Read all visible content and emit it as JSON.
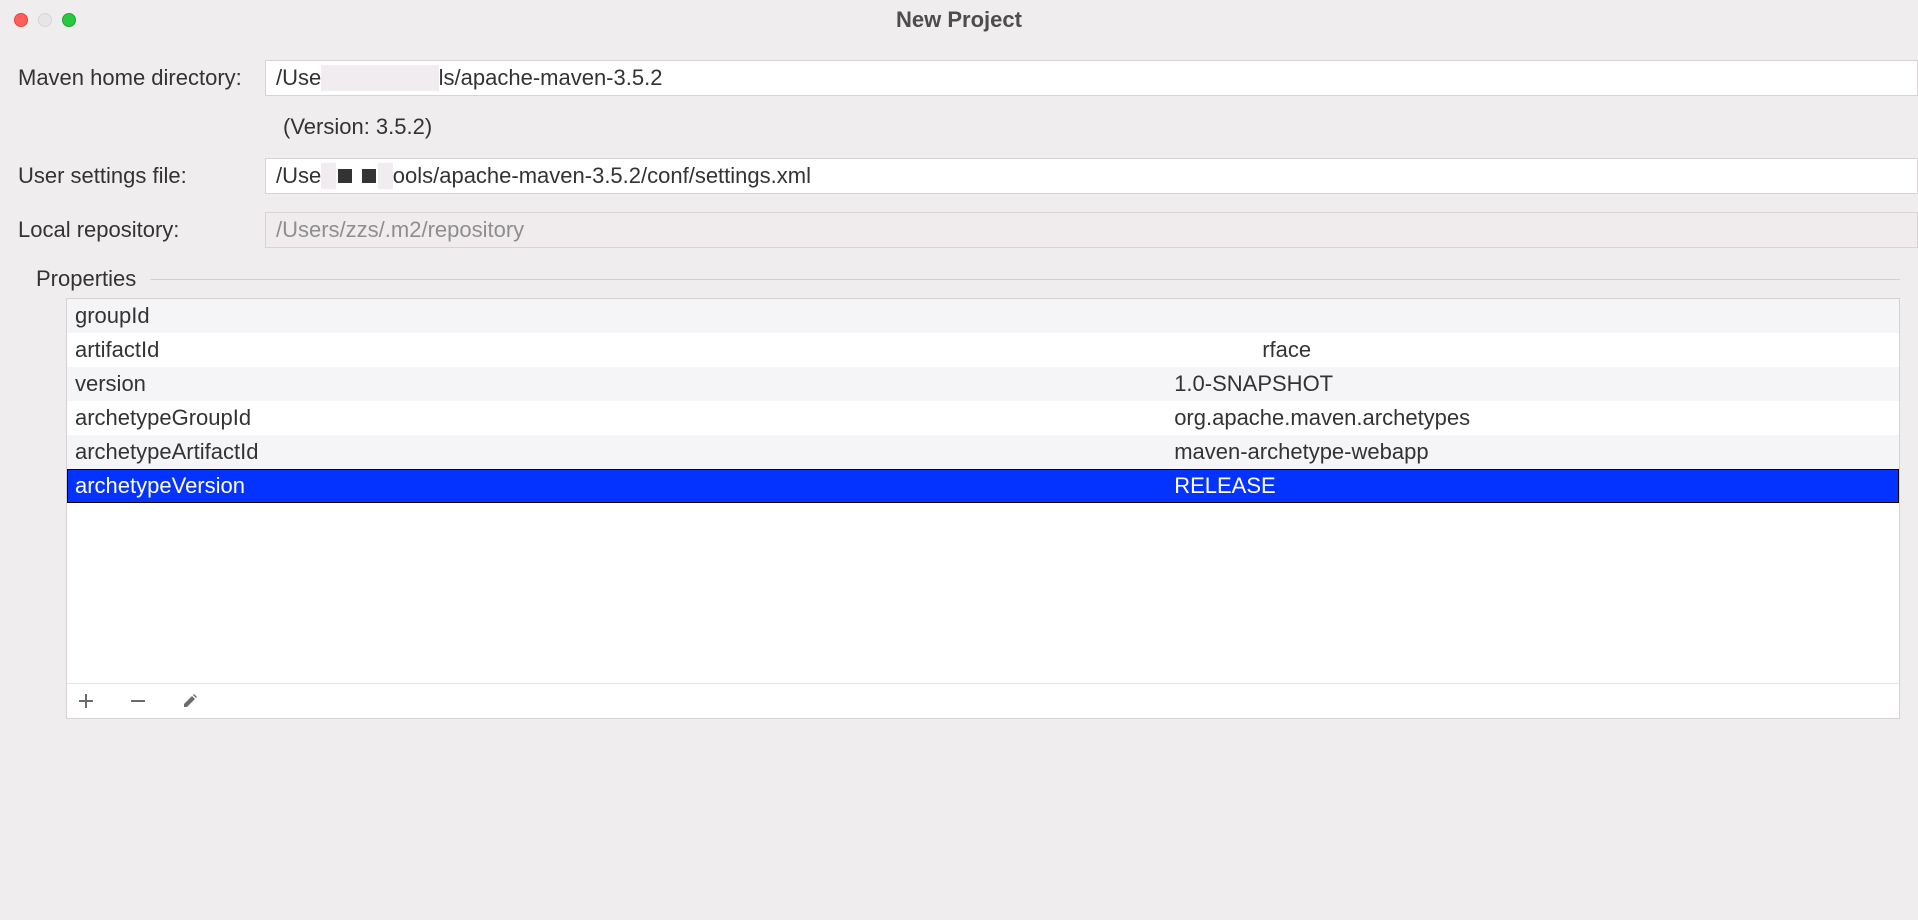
{
  "title": "New Project",
  "rows": {
    "mavenHome": {
      "label": "Maven home directory:",
      "prefix": "/Use",
      "suffix": "ls/apache-maven-3.5.2"
    },
    "versionNote": "(Version: 3.5.2)",
    "userSettings": {
      "label": "User settings file:",
      "prefix": "/Use",
      "suffix": "ools/apache-maven-3.5.2/conf/settings.xml"
    },
    "localRepo": {
      "label": "Local repository:",
      "value": "/Users/zzs/.m2/repository"
    }
  },
  "propertiesLabel": "Properties",
  "properties": [
    {
      "key": "groupId",
      "val": ""
    },
    {
      "key": "artifactId",
      "valSuffix": "rface"
    },
    {
      "key": "version",
      "val": "1.0-SNAPSHOT"
    },
    {
      "key": "archetypeGroupId",
      "val": "org.apache.maven.archetypes"
    },
    {
      "key": "archetypeArtifactId",
      "val": "maven-archetype-webapp"
    },
    {
      "key": "archetypeVersion",
      "val": "RELEASE"
    }
  ],
  "selectedIndex": 5
}
